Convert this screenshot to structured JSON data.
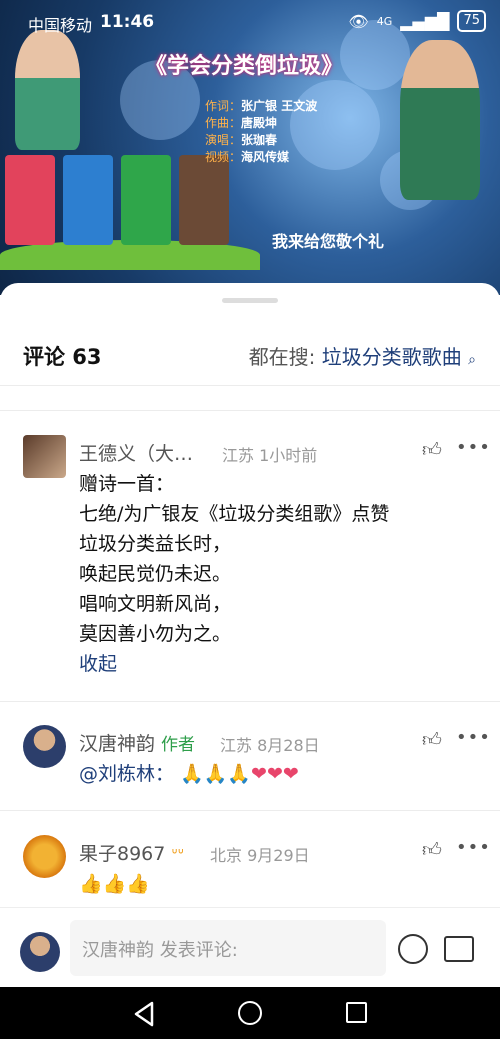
{
  "status_bar": {
    "carrier": "中国移动",
    "time": "11:46",
    "network": "4G",
    "battery": "75"
  },
  "video": {
    "title": "《学会分类倒垃圾》",
    "credits": [
      {
        "label": "作词：",
        "value": "张广银 王文波"
      },
      {
        "label": "作曲：",
        "value": "唐殿坤"
      },
      {
        "label": "演唱：",
        "value": "张珈春"
      },
      {
        "label": "视频：",
        "value": "海风传媒"
      }
    ],
    "caption": "我来给您敬个礼"
  },
  "comments_header": {
    "count_label": "评论 63",
    "search_prefix": "都在搜:",
    "search_keyword": "垃圾分类歌歌曲"
  },
  "comments": [
    {
      "name": "王德义（大…",
      "location": "江苏",
      "time": "1小时前",
      "lines": [
        "赠诗一首：",
        "七绝/为广银友《垃圾分类组歌》点赞",
        "垃圾分类益长时，",
        "唤起民觉仍未迟。",
        "唱响文明新风尚，",
        "莫因善小勿为之。"
      ],
      "collapse_label": "收起"
    },
    {
      "name": "汉唐神韵",
      "author_tag": "作者",
      "location": "江苏",
      "time": "8月28日",
      "mention": "@刘栋林：",
      "emojis": "🙏🙏🙏❤❤❤"
    },
    {
      "name": "果子8967",
      "location": "北京",
      "time": "9月29日",
      "emojis": "👍👍👍"
    }
  ],
  "input_bar": {
    "placeholder": "汉唐神韵 发表评论:"
  },
  "icons": {
    "like": "thumbs-up-icon",
    "more": "more-icon",
    "emoji": "emoji-icon",
    "image": "image-icon",
    "search": "search-icon"
  },
  "colors": {
    "link": "#1f3f7a",
    "author_tag": "#2e9e4a"
  }
}
